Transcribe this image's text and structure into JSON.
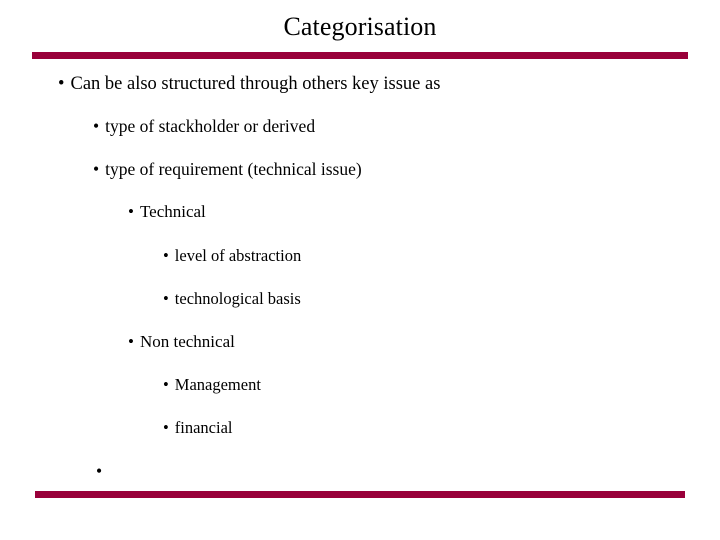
{
  "slide": {
    "title": "Categorisation",
    "accent_color": "#99003a",
    "text_color": "#000000",
    "background_color": "#ffffff",
    "bullet_glyph": "•",
    "bullets": [
      {
        "level": 1,
        "marker": "•",
        "text": "Can be also structured through others key issue as"
      },
      {
        "level": 2,
        "marker": "•",
        "text": "type of stackholder or derived"
      },
      {
        "level": 2,
        "marker": "•",
        "text": "type of requirement (technical issue)"
      },
      {
        "level": 3,
        "marker": "•",
        "text": "Technical"
      },
      {
        "level": 4,
        "marker": "•",
        "text": "level of abstraction"
      },
      {
        "level": 4,
        "marker": "•",
        "text": "technological basis"
      },
      {
        "level": 3,
        "marker": "•",
        "text": "Non technical"
      },
      {
        "level": 4,
        "marker": "•",
        "text": "Management"
      },
      {
        "level": 4,
        "marker": "•",
        "text": "financial"
      },
      {
        "level": 2,
        "marker": "•",
        "text": ""
      }
    ]
  }
}
